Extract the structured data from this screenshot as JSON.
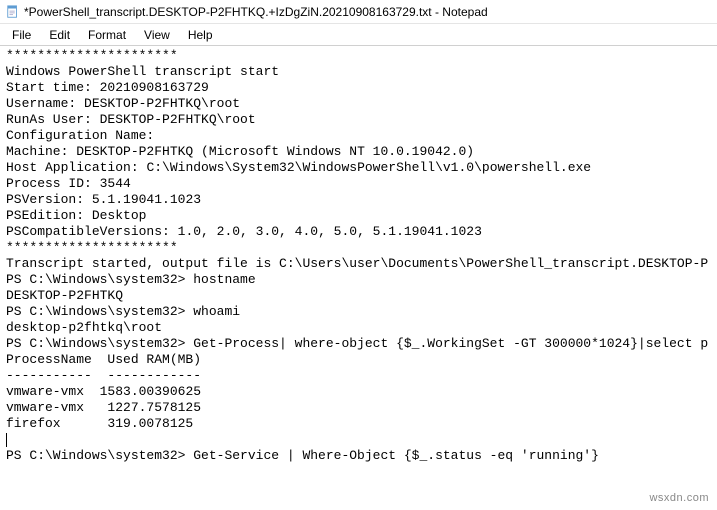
{
  "window": {
    "title": "*PowerShell_transcript.DESKTOP-P2FHTKQ.+IzDgZiN.20210908163729.txt - Notepad"
  },
  "menu": {
    "file": "File",
    "edit": "Edit",
    "format": "Format",
    "view": "View",
    "help": "Help"
  },
  "transcript": {
    "sep1": "**********************",
    "header_start": "Windows PowerShell transcript start",
    "start_time_label": "Start time: ",
    "start_time": "20210908163729",
    "username_label": "Username: ",
    "username": "DESKTOP-P2FHTKQ\\root",
    "runas_label": "RunAs User: ",
    "runas": "DESKTOP-P2FHTKQ\\root",
    "config_label": "Configuration Name: ",
    "machine_label": "Machine: ",
    "machine": "DESKTOP-P2FHTKQ (Microsoft Windows NT 10.0.19042.0)",
    "hostapp_label": "Host Application: ",
    "hostapp": "C:\\Windows\\System32\\WindowsPowerShell\\v1.0\\powershell.exe",
    "pid_label": "Process ID: ",
    "pid": "3544",
    "psversion_label": "PSVersion: ",
    "psversion": "5.1.19041.1023",
    "psedition_label": "PSEdition: ",
    "psedition": "Desktop",
    "pscompat_label": "PSCompatibleVersions: ",
    "pscompat": "1.0, 2.0, 3.0, 4.0, 5.0, 5.1.19041.1023",
    "sep2": "**********************",
    "transcript_started": "Transcript started, output file is C:\\Users\\user\\Documents\\PowerShell_transcript.DESKTOP-P",
    "prompt1": "PS C:\\Windows\\system32> ",
    "cmd1": "hostname",
    "out1": "DESKTOP-P2FHTKQ",
    "prompt2": "PS C:\\Windows\\system32> ",
    "cmd2": "whoami",
    "out2": "desktop-p2fhtkq\\root",
    "prompt3": "PS C:\\Windows\\system32> ",
    "cmd3": "Get-Process| where-object {$_.WorkingSet -GT 300000*1024}|select p",
    "proc_header": "ProcessName  Used RAM(MB)",
    "proc_underline": "-----------  ------------",
    "row1_name": "vmware-vmx",
    "row1_val": "1583.00390625",
    "row2_name": "vmware-vmx",
    "row2_val": "1227.7578125",
    "row3_name": "firefox",
    "row3_val": "319.0078125",
    "prompt4": "PS C:\\Windows\\system32> ",
    "cmd4": "Get-Service | Where-Object {$_.status -eq 'running'}"
  },
  "watermark": "wsxdn.com"
}
